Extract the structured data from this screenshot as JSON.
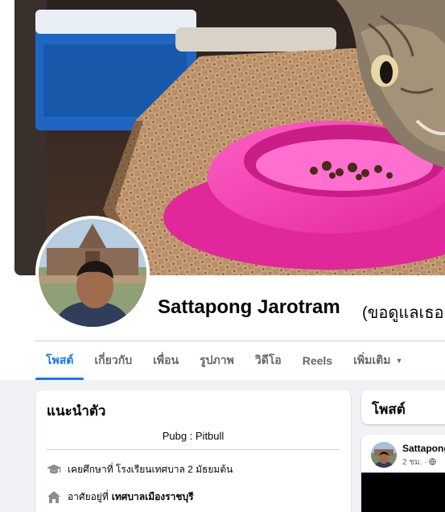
{
  "profile": {
    "name": "Sattapong Jarotram",
    "alternate_name": "(ขอดูแลเธอ"
  },
  "tabs": [
    {
      "label": "โพสต์",
      "active": true
    },
    {
      "label": "เกี่ยวกับ",
      "active": false
    },
    {
      "label": "เพื่อน",
      "active": false
    },
    {
      "label": "รูปภาพ",
      "active": false
    },
    {
      "label": "วิดีโอ",
      "active": false
    },
    {
      "label": "Reels",
      "active": false
    },
    {
      "label": "เพิ่มเติม",
      "active": false,
      "icon": "caret-down-icon"
    }
  ],
  "intro": {
    "title": "แนะนำตัว",
    "bio": "Pubg : Pitbull",
    "education_prefix": "เคยศึกษาที่ โรงเรียนเทศบาล 2 มัธยมต้น",
    "education_icon": "graduation-cap-icon",
    "lives_prefix": "อาศัยอยู่ที่",
    "lives_place": "เทศบาลเมืองราชบุรี",
    "lives_icon": "house-icon"
  },
  "posts": {
    "title": "โพสต์",
    "preview_author": "Sattapong",
    "preview_meta": "2 ชม. ·",
    "privacy_icon": "globe-icon"
  },
  "colors": {
    "accent": "#1877f2",
    "secondary_text": "#65676b",
    "background": "#f0f2f5"
  }
}
